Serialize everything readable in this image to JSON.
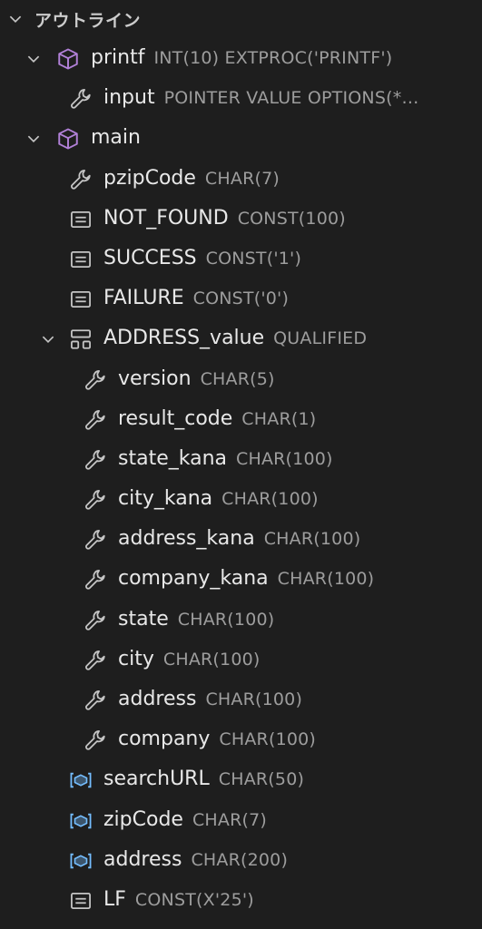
{
  "outline": {
    "title": "アウトライン",
    "items": [
      {
        "name": "printf",
        "desc": "INT(10) EXTPROC('PRINTF')",
        "icon": "cube-icon",
        "depth": 0,
        "expanded": true
      },
      {
        "name": "input",
        "desc": "POINTER VALUE OPTIONS(*…",
        "icon": "wrench-icon",
        "depth": 1
      },
      {
        "name": "main",
        "desc": "",
        "icon": "cube-icon",
        "depth": 0,
        "expanded": true
      },
      {
        "name": "pzipCode",
        "desc": "CHAR(7)",
        "icon": "wrench-icon",
        "depth": 1
      },
      {
        "name": "NOT_FOUND",
        "desc": "CONST(100)",
        "icon": "constant-icon",
        "depth": 1
      },
      {
        "name": "SUCCESS",
        "desc": "CONST('1')",
        "icon": "constant-icon",
        "depth": 1
      },
      {
        "name": "FAILURE",
        "desc": "CONST('0')",
        "icon": "constant-icon",
        "depth": 1
      },
      {
        "name": "ADDRESS_value",
        "desc": "QUALIFIED",
        "icon": "struct-icon",
        "depth": 1,
        "expanded": true
      },
      {
        "name": "version",
        "desc": "CHAR(5)",
        "icon": "wrench-icon",
        "depth": 2
      },
      {
        "name": "result_code",
        "desc": "CHAR(1)",
        "icon": "wrench-icon",
        "depth": 2
      },
      {
        "name": "state_kana",
        "desc": "CHAR(100)",
        "icon": "wrench-icon",
        "depth": 2
      },
      {
        "name": "city_kana",
        "desc": "CHAR(100)",
        "icon": "wrench-icon",
        "depth": 2
      },
      {
        "name": "address_kana",
        "desc": "CHAR(100)",
        "icon": "wrench-icon",
        "depth": 2
      },
      {
        "name": "company_kana",
        "desc": "CHAR(100)",
        "icon": "wrench-icon",
        "depth": 2
      },
      {
        "name": "state",
        "desc": "CHAR(100)",
        "icon": "wrench-icon",
        "depth": 2
      },
      {
        "name": "city",
        "desc": "CHAR(100)",
        "icon": "wrench-icon",
        "depth": 2
      },
      {
        "name": "address",
        "desc": "CHAR(100)",
        "icon": "wrench-icon",
        "depth": 2
      },
      {
        "name": "company",
        "desc": "CHAR(100)",
        "icon": "wrench-icon",
        "depth": 2
      },
      {
        "name": "searchURL",
        "desc": "CHAR(50)",
        "icon": "variable-icon",
        "depth": 1
      },
      {
        "name": "zipCode",
        "desc": "CHAR(7)",
        "icon": "variable-icon",
        "depth": 1
      },
      {
        "name": "address",
        "desc": "CHAR(200)",
        "icon": "variable-icon",
        "depth": 1
      },
      {
        "name": "LF",
        "desc": "CONST(X'25')",
        "icon": "constant-icon",
        "depth": 1
      }
    ]
  },
  "colors": {
    "background": "#1e1e1e",
    "label": "#e6e6e6",
    "description": "#9d9d9d",
    "cube_icon": "#b180d7",
    "variable_icon": "#75beff",
    "default_icon": "#c5c5c5"
  }
}
